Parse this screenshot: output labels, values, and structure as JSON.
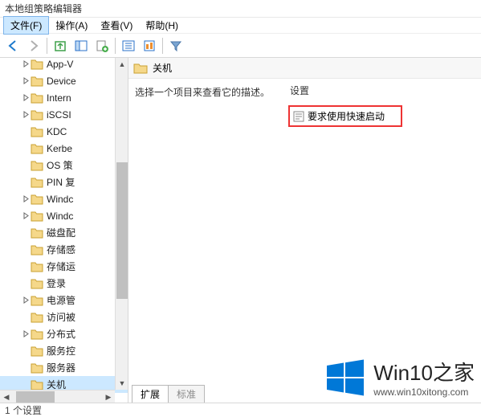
{
  "window": {
    "title": "本地组策略编辑器"
  },
  "menu": {
    "file": "文件(F)",
    "action": "操作(A)",
    "view": "查看(V)",
    "help": "帮助(H)"
  },
  "tree": {
    "items": [
      {
        "label": "App-V",
        "expandable": true
      },
      {
        "label": "Device",
        "expandable": true
      },
      {
        "label": "Intern",
        "expandable": true
      },
      {
        "label": "iSCSI",
        "expandable": true
      },
      {
        "label": "KDC",
        "expandable": false
      },
      {
        "label": "Kerbe",
        "expandable": false
      },
      {
        "label": "OS 策",
        "expandable": false
      },
      {
        "label": "PIN 复",
        "expandable": false
      },
      {
        "label": "Windc",
        "expandable": true
      },
      {
        "label": "Windc",
        "expandable": true
      },
      {
        "label": "磁盘配",
        "expandable": false
      },
      {
        "label": "存储感",
        "expandable": false
      },
      {
        "label": "存储运",
        "expandable": false
      },
      {
        "label": "登录",
        "expandable": false
      },
      {
        "label": "电源管",
        "expandable": true
      },
      {
        "label": "访问被",
        "expandable": false
      },
      {
        "label": "分布式",
        "expandable": true
      },
      {
        "label": "服务控",
        "expandable": false
      },
      {
        "label": "服务器",
        "expandable": false
      },
      {
        "label": "关机",
        "expandable": false,
        "selected": true
      }
    ]
  },
  "detail": {
    "header": "关机",
    "description": "选择一个项目来查看它的描述。",
    "list_header": "设置",
    "settings": [
      {
        "label": "要求使用快速启动"
      }
    ]
  },
  "tabs": {
    "extended": "扩展",
    "standard": "标准"
  },
  "statusbar": {
    "text": "1 个设置"
  },
  "watermark": {
    "brand_prefix": "Win10",
    "brand_suffix": "之家",
    "url": "www.win10xitong.com"
  }
}
